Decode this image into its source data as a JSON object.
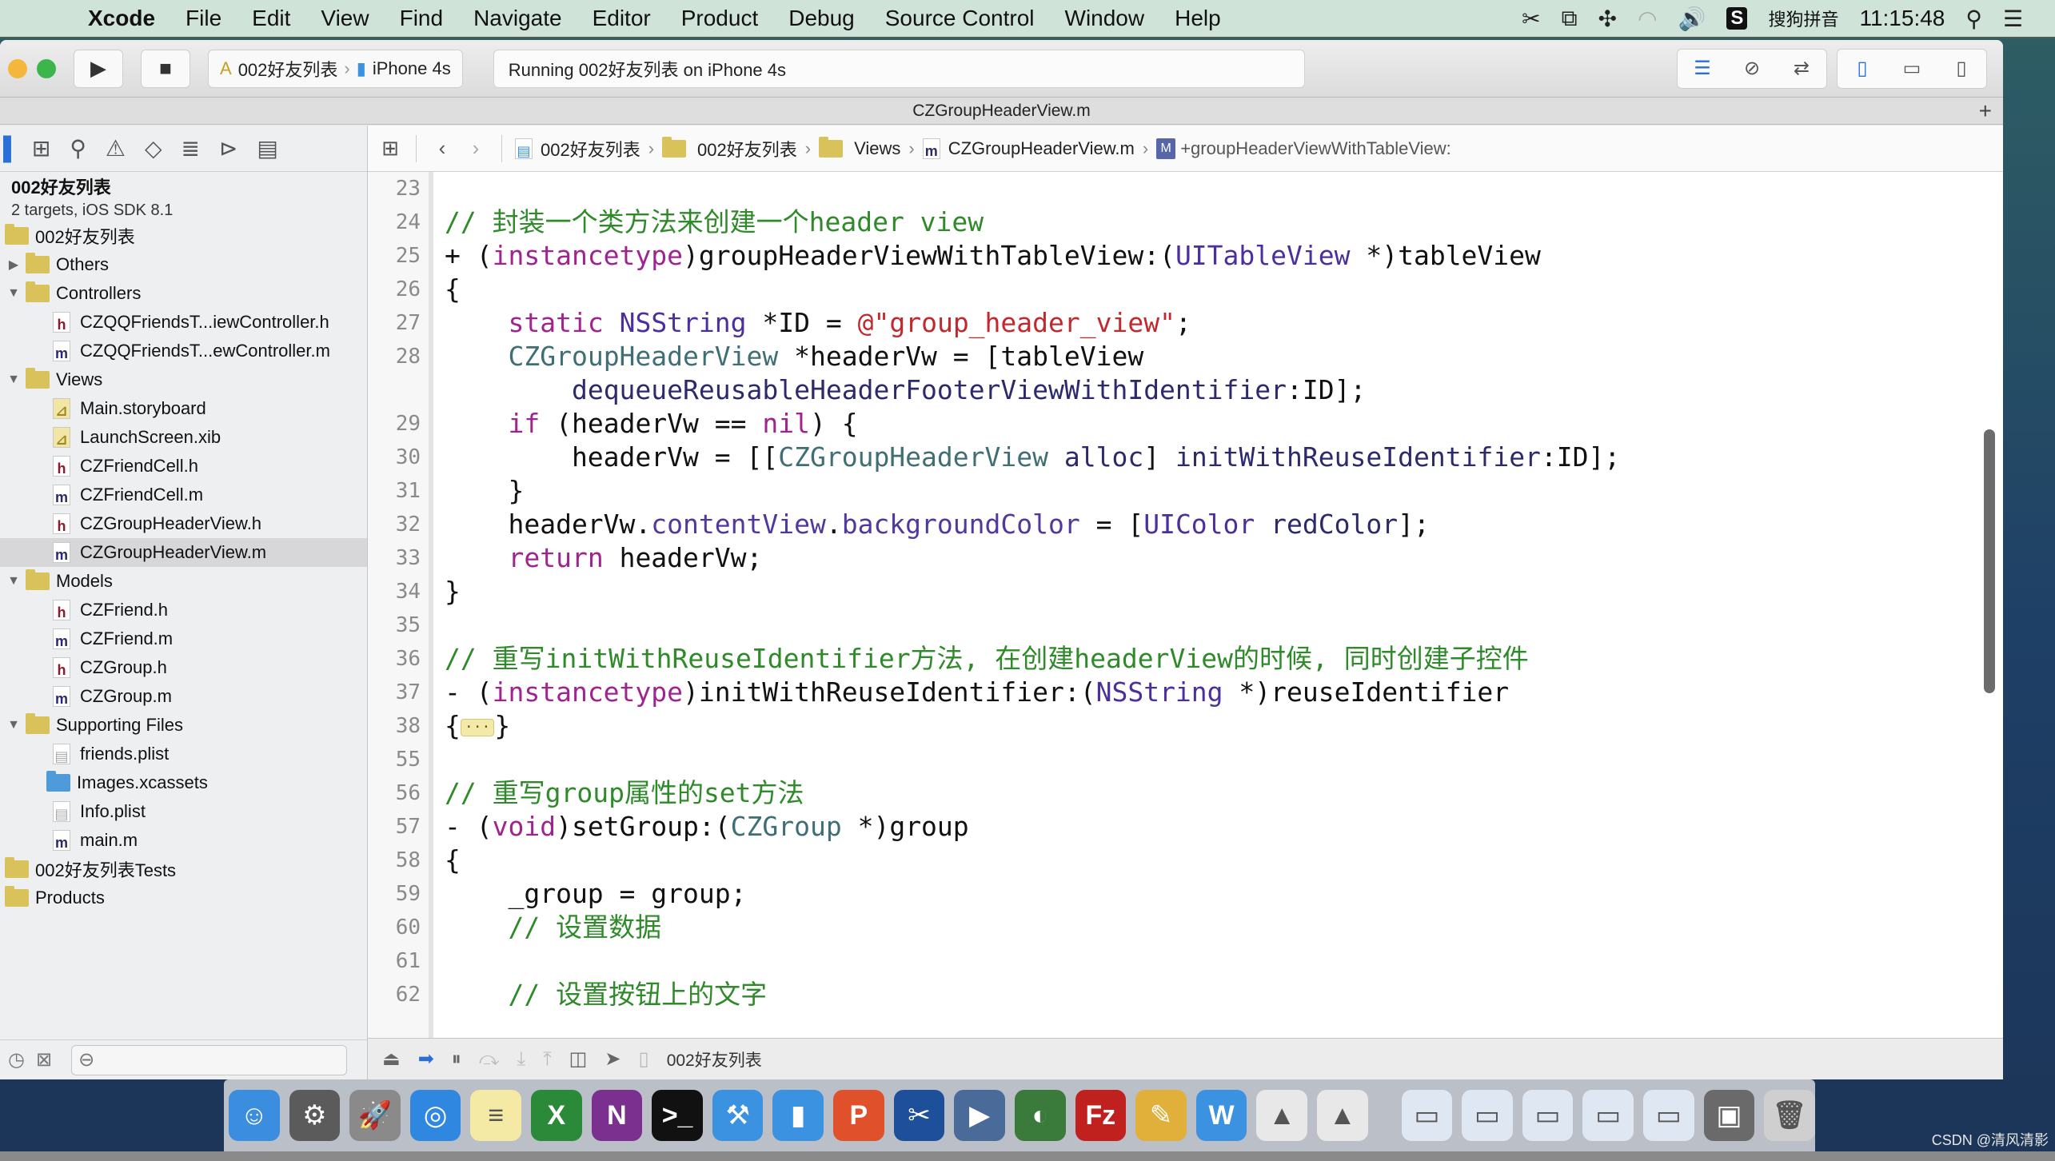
{
  "menubar": {
    "app_name": "Xcode",
    "items": [
      "File",
      "Edit",
      "View",
      "Find",
      "Navigate",
      "Editor",
      "Product",
      "Debug",
      "Source Control",
      "Window",
      "Help"
    ],
    "input_method_badge": "S",
    "input_method": "搜狗拼音",
    "clock": "11:15:48"
  },
  "toolbar": {
    "scheme_target": "002好友列表",
    "scheme_device": "iPhone 4s",
    "activity_status": "Running 002好友列表 on iPhone 4s"
  },
  "tab": {
    "title": "CZGroupHeaderView.m",
    "add_label": "+"
  },
  "navigator": {
    "project_name": "002好友列表",
    "project_subtitle": "2 targets, iOS SDK 8.1",
    "tree": [
      {
        "label": "002好友列表",
        "kind": "folder",
        "level": 0,
        "disclosure": ""
      },
      {
        "label": "Others",
        "kind": "folder",
        "level": 1,
        "disclosure": "▶"
      },
      {
        "label": "Controllers",
        "kind": "folder",
        "level": 1,
        "disclosure": "▼"
      },
      {
        "label": "CZQQFriendsT...iewController.h",
        "kind": "h",
        "level": 2
      },
      {
        "label": "CZQQFriendsT...ewController.m",
        "kind": "m",
        "level": 2
      },
      {
        "label": "Views",
        "kind": "folder",
        "level": 1,
        "disclosure": "▼"
      },
      {
        "label": "Main.storyboard",
        "kind": "sb",
        "level": 2
      },
      {
        "label": "LaunchScreen.xib",
        "kind": "sb",
        "level": 2
      },
      {
        "label": "CZFriendCell.h",
        "kind": "h",
        "level": 2
      },
      {
        "label": "CZFriendCell.m",
        "kind": "m",
        "level": 2
      },
      {
        "label": "CZGroupHeaderView.h",
        "kind": "h",
        "level": 2
      },
      {
        "label": "CZGroupHeaderView.m",
        "kind": "m",
        "level": 2,
        "selected": true
      },
      {
        "label": "Models",
        "kind": "folder",
        "level": 1,
        "disclosure": "▼"
      },
      {
        "label": "CZFriend.h",
        "kind": "h",
        "level": 2
      },
      {
        "label": "CZFriend.m",
        "kind": "m",
        "level": 2
      },
      {
        "label": "CZGroup.h",
        "kind": "h",
        "level": 2
      },
      {
        "label": "CZGroup.m",
        "kind": "m",
        "level": 2
      },
      {
        "label": "Supporting Files",
        "kind": "folder",
        "level": 1,
        "disclosure": "▼"
      },
      {
        "label": "friends.plist",
        "kind": "pl",
        "level": 2
      },
      {
        "label": "Images.xcassets",
        "kind": "assets",
        "level": 2
      },
      {
        "label": "Info.plist",
        "kind": "pl",
        "level": 2
      },
      {
        "label": "main.m",
        "kind": "m",
        "level": 2
      },
      {
        "label": "002好友列表Tests",
        "kind": "folder",
        "level": 0,
        "disclosure": ""
      },
      {
        "label": "Products",
        "kind": "folder",
        "level": 0,
        "disclosure": ""
      }
    ]
  },
  "jumpbar": {
    "crumbs": [
      "002好友列表",
      "002好友列表",
      "Views",
      "CZGroupHeaderView.m"
    ],
    "method_badge": "M",
    "method": "+groupHeaderViewWithTableView:"
  },
  "editor": {
    "lines": [
      {
        "n": "23",
        "segs": []
      },
      {
        "n": "24",
        "segs": [
          [
            "c-comment",
            "// 封装一个类方法来创建一个header view"
          ]
        ]
      },
      {
        "n": "25",
        "segs": [
          [
            "",
            "+ ("
          ],
          [
            "c-kw",
            "instancetype"
          ],
          [
            "",
            ")groupHeaderViewWithTableView:("
          ],
          [
            "c-type",
            "UITableView"
          ],
          [
            "",
            " *)tableView"
          ]
        ]
      },
      {
        "n": "26",
        "segs": [
          [
            "",
            "{"
          ]
        ]
      },
      {
        "n": "27",
        "segs": [
          [
            "",
            "    "
          ],
          [
            "c-kw",
            "static"
          ],
          [
            "",
            " "
          ],
          [
            "c-type",
            "NSString"
          ],
          [
            "",
            " *ID = "
          ],
          [
            "c-str",
            "@\"group_header_view\""
          ],
          [
            "",
            ";"
          ]
        ]
      },
      {
        "n": "28",
        "segs": [
          [
            "",
            "    "
          ],
          [
            "c-proj",
            "CZGroupHeaderView"
          ],
          [
            "",
            " *headerVw = [tableView"
          ]
        ]
      },
      {
        "n": "",
        "segs": [
          [
            "",
            "        "
          ],
          [
            "c-method",
            "dequeueReusableHeaderFooterViewWithIdentifier"
          ],
          [
            "",
            ":ID];"
          ]
        ]
      },
      {
        "n": "29",
        "segs": [
          [
            "",
            "    "
          ],
          [
            "c-kw",
            "if"
          ],
          [
            "",
            " (headerVw == "
          ],
          [
            "c-kw",
            "nil"
          ],
          [
            "",
            ") {"
          ]
        ]
      },
      {
        "n": "30",
        "segs": [
          [
            "",
            "        headerVw = [["
          ],
          [
            "c-proj",
            "CZGroupHeaderView"
          ],
          [
            "",
            " "
          ],
          [
            "c-method",
            "alloc"
          ],
          [
            "",
            "] "
          ],
          [
            "c-method",
            "initWithReuseIdentifier"
          ],
          [
            "",
            ":ID];"
          ]
        ]
      },
      {
        "n": "31",
        "segs": [
          [
            "",
            "    }"
          ]
        ]
      },
      {
        "n": "32",
        "segs": [
          [
            "",
            "    headerVw."
          ],
          [
            "c-prop",
            "contentView"
          ],
          [
            "",
            "."
          ],
          [
            "c-prop",
            "backgroundColor"
          ],
          [
            "",
            " = ["
          ],
          [
            "c-type",
            "UIColor"
          ],
          [
            "",
            " "
          ],
          [
            "c-method",
            "redColor"
          ],
          [
            "",
            "];"
          ]
        ]
      },
      {
        "n": "33",
        "segs": [
          [
            "",
            "    "
          ],
          [
            "c-kw",
            "return"
          ],
          [
            "",
            " headerVw;"
          ]
        ]
      },
      {
        "n": "34",
        "segs": [
          [
            "",
            "}"
          ]
        ]
      },
      {
        "n": "35",
        "segs": []
      },
      {
        "n": "36",
        "segs": [
          [
            "c-comment",
            "// 重写initWithReuseIdentifier方法, 在创建headerView的时候, 同时创建子控件"
          ]
        ]
      },
      {
        "n": "37",
        "segs": [
          [
            "",
            "- ("
          ],
          [
            "c-kw",
            "instancetype"
          ],
          [
            "",
            ")initWithReuseIdentifier:("
          ],
          [
            "c-type",
            "NSString"
          ],
          [
            "",
            " *)reuseIdentifier"
          ]
        ]
      },
      {
        "n": "38",
        "segs": [
          [
            "",
            "{"
          ],
          [
            "fold",
            "···"
          ],
          [
            "",
            "}"
          ]
        ]
      },
      {
        "n": "55",
        "segs": []
      },
      {
        "n": "56",
        "segs": [
          [
            "c-comment",
            "// 重写group属性的set方法"
          ]
        ]
      },
      {
        "n": "57",
        "segs": [
          [
            "",
            "- ("
          ],
          [
            "c-kw",
            "void"
          ],
          [
            "",
            ")setGroup:("
          ],
          [
            "c-proj",
            "CZGroup"
          ],
          [
            "",
            " *)group"
          ]
        ]
      },
      {
        "n": "58",
        "segs": [
          [
            "",
            "{"
          ]
        ]
      },
      {
        "n": "59",
        "segs": [
          [
            "",
            "    _group = group;"
          ]
        ]
      },
      {
        "n": "60",
        "segs": [
          [
            "",
            "    "
          ],
          [
            "c-comment",
            "// 设置数据"
          ]
        ]
      },
      {
        "n": "61",
        "segs": []
      },
      {
        "n": "62",
        "segs": [
          [
            "",
            "    "
          ],
          [
            "c-comment",
            "// 设置按钮上的文字"
          ]
        ]
      }
    ]
  },
  "debugbar": {
    "process": "002好友列表"
  },
  "dock": {
    "apps": [
      {
        "name": "finder",
        "glyph": "☺",
        "color": "#3b8de0"
      },
      {
        "name": "system-preferences",
        "glyph": "⚙",
        "color": "#5b5b5b"
      },
      {
        "name": "launchpad",
        "glyph": "🚀",
        "color": "#8a8a8a"
      },
      {
        "name": "safari",
        "glyph": "◎",
        "color": "#2f87e0"
      },
      {
        "name": "notes",
        "glyph": "≡",
        "color": "#f5e9a6"
      },
      {
        "name": "excel",
        "glyph": "X",
        "color": "#2a8a3a"
      },
      {
        "name": "onenote",
        "glyph": "N",
        "color": "#7b2f8f"
      },
      {
        "name": "terminal",
        "glyph": ">_",
        "color": "#111111"
      },
      {
        "name": "xcode",
        "glyph": "⚒",
        "color": "#3a92e0"
      },
      {
        "name": "simulator",
        "glyph": "▮",
        "color": "#3a92e0"
      },
      {
        "name": "powerpoint",
        "glyph": "P",
        "color": "#e0502a"
      },
      {
        "name": "screenshot-tool",
        "glyph": "✂",
        "color": "#1d4f9a"
      },
      {
        "name": "video-app",
        "glyph": "▶",
        "color": "#4a6a9a"
      },
      {
        "name": "network-app",
        "glyph": "◐",
        "color": "#3a7a3a"
      },
      {
        "name": "filezilla",
        "glyph": "Fz",
        "color": "#c0201e"
      },
      {
        "name": "tools-app",
        "glyph": "✎",
        "color": "#e0b03a"
      },
      {
        "name": "word",
        "glyph": "W",
        "color": "#3a92e0"
      },
      {
        "name": "document-1",
        "glyph": "▲",
        "color": "#e8e8e8"
      },
      {
        "name": "document-2",
        "glyph": "▲",
        "color": "#e8e8e8"
      },
      {
        "name": "window-thumb-1",
        "glyph": "▭",
        "color": "#dfe8f2"
      },
      {
        "name": "window-thumb-2",
        "glyph": "▭",
        "color": "#dfe8f2"
      },
      {
        "name": "window-thumb-3",
        "glyph": "▭",
        "color": "#dfe8f2"
      },
      {
        "name": "window-thumb-4",
        "glyph": "▭",
        "color": "#dfe8f2"
      },
      {
        "name": "window-thumb-5",
        "glyph": "▭",
        "color": "#dfe8f2"
      },
      {
        "name": "display-thumb",
        "glyph": "▣",
        "color": "#6a6a6a"
      },
      {
        "name": "trash",
        "glyph": "🗑",
        "color": "#cfcfcf"
      }
    ]
  },
  "watermark": "CSDN @清风清影"
}
